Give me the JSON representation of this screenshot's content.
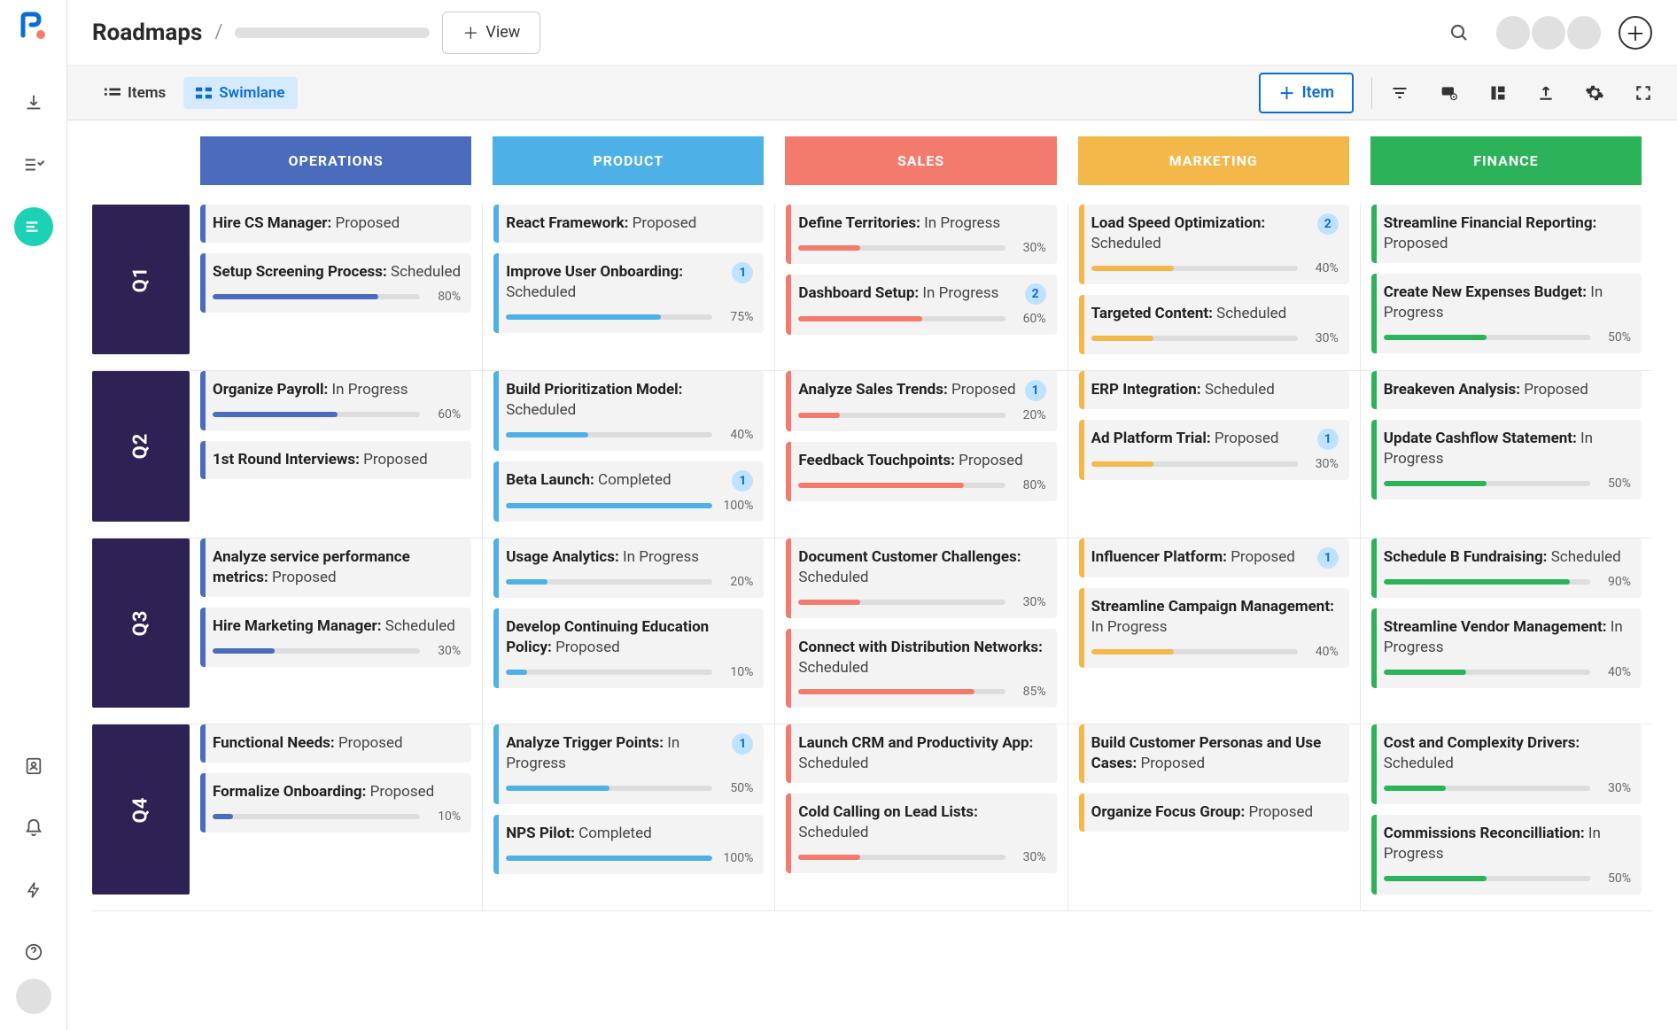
{
  "app_title": "Roadmaps",
  "view_button": "View",
  "tabs": {
    "items": "Items",
    "swimlane": "Swimlane"
  },
  "add_item": "Item",
  "colors": {
    "operations": "#4b6bbd",
    "product": "#4db1e8",
    "sales": "#f27b6e",
    "marketing": "#f4b84a",
    "finance": "#2cb35a"
  },
  "columns": [
    {
      "id": "operations",
      "label": "OPERATIONS"
    },
    {
      "id": "product",
      "label": "PRODUCT"
    },
    {
      "id": "sales",
      "label": "SALES"
    },
    {
      "id": "marketing",
      "label": "MARKETING"
    },
    {
      "id": "finance",
      "label": "FINANCE"
    }
  ],
  "rows": [
    {
      "id": "q1",
      "label": "Q1",
      "cells": {
        "operations": [
          {
            "title": "Hire CS Manager:",
            "status": "Proposed"
          },
          {
            "title": "Setup Screening Process:",
            "status": "Scheduled",
            "pct": 80
          }
        ],
        "product": [
          {
            "title": "React Framework:",
            "status": "Proposed"
          },
          {
            "title": "Improve User Onboarding:",
            "status": "Scheduled",
            "pct": 75,
            "badge": 1
          }
        ],
        "sales": [
          {
            "title": "Define Territories:",
            "status": "In Progress",
            "pct": 30
          },
          {
            "title": "Dashboard Setup:",
            "status": "In Progress",
            "pct": 60,
            "badge": 2
          }
        ],
        "marketing": [
          {
            "title": "Load Speed Optimization:",
            "status": "Scheduled",
            "pct": 40,
            "badge": 2
          },
          {
            "title": "Targeted Content:",
            "status": "Scheduled",
            "pct": 30
          }
        ],
        "finance": [
          {
            "title": "Streamline Financial Reporting:",
            "status": "Proposed"
          },
          {
            "title": "Create New Expenses Budget:",
            "status": "In Progress",
            "pct": 50
          }
        ]
      }
    },
    {
      "id": "q2",
      "label": "Q2",
      "cells": {
        "operations": [
          {
            "title": "Organize Payroll:",
            "status": "In Progress",
            "pct": 60
          },
          {
            "title": "1st Round Interviews:",
            "status": "Proposed"
          }
        ],
        "product": [
          {
            "title": "Build Prioritization Model:",
            "status": "Scheduled",
            "pct": 40
          },
          {
            "title": "Beta Launch:",
            "status": "Completed",
            "pct": 100,
            "badge": 1
          }
        ],
        "sales": [
          {
            "title": "Analyze Sales Trends:",
            "status": "Proposed",
            "pct": 20,
            "badge": 1
          },
          {
            "title": "Feedback Touchpoints:",
            "status": "Proposed",
            "pct": 80
          }
        ],
        "marketing": [
          {
            "title": "ERP Integration:",
            "status": "Scheduled"
          },
          {
            "title": "Ad Platform Trial:",
            "status": "Proposed",
            "pct": 30,
            "badge": 1
          }
        ],
        "finance": [
          {
            "title": "Breakeven Analysis:",
            "status": "Proposed"
          },
          {
            "title": "Update Cashflow Statement:",
            "status": "In Progress",
            "pct": 50
          }
        ]
      }
    },
    {
      "id": "q3",
      "label": "Q3",
      "cells": {
        "operations": [
          {
            "title": "Analyze service performance metrics:",
            "status": "Proposed"
          },
          {
            "title": "Hire Marketing Manager:",
            "status": "Scheduled",
            "pct": 30
          }
        ],
        "product": [
          {
            "title": "Usage Analytics:",
            "status": "In Progress",
            "pct": 20
          },
          {
            "title": "Develop Continuing Education Policy:",
            "status": "Proposed",
            "pct": 10
          }
        ],
        "sales": [
          {
            "title": "Document Customer Challenges:",
            "status": "Scheduled",
            "pct": 30
          },
          {
            "title": "Connect with Distribution Networks:",
            "status": "Scheduled",
            "pct": 85
          }
        ],
        "marketing": [
          {
            "title": "Influencer Platform:",
            "status": "Proposed",
            "badge": 1
          },
          {
            "title": "Streamline Campaign Management:",
            "status": "In Progress",
            "pct": 40
          }
        ],
        "finance": [
          {
            "title": "Schedule B Fundraising:",
            "status": "Scheduled",
            "pct": 90
          },
          {
            "title": "Streamline Vendor Management:",
            "status": "In Progress",
            "pct": 40
          }
        ]
      }
    },
    {
      "id": "q4",
      "label": "Q4",
      "cells": {
        "operations": [
          {
            "title": "Functional Needs:",
            "status": "Proposed"
          },
          {
            "title": "Formalize Onboarding:",
            "status": "Proposed",
            "pct": 10
          }
        ],
        "product": [
          {
            "title": "Analyze Trigger Points:",
            "status": "In Progress",
            "pct": 50,
            "badge": 1
          },
          {
            "title": "NPS Pilot:",
            "status": "Completed",
            "pct": 100
          }
        ],
        "sales": [
          {
            "title": "Launch CRM and Productivity App:",
            "status": "Scheduled"
          },
          {
            "title": "Cold Calling on Lead Lists:",
            "status": "Scheduled",
            "pct": 30
          }
        ],
        "marketing": [
          {
            "title": "Build Customer Personas and Use Cases:",
            "status": "Proposed"
          },
          {
            "title": "Organize Focus Group:",
            "status": "Proposed"
          }
        ],
        "finance": [
          {
            "title": "Cost and Complexity Drivers:",
            "status": "Scheduled",
            "pct": 30
          },
          {
            "title": "Commissions Reconcilliation:",
            "status": "In Progress",
            "pct": 50
          }
        ]
      }
    }
  ]
}
